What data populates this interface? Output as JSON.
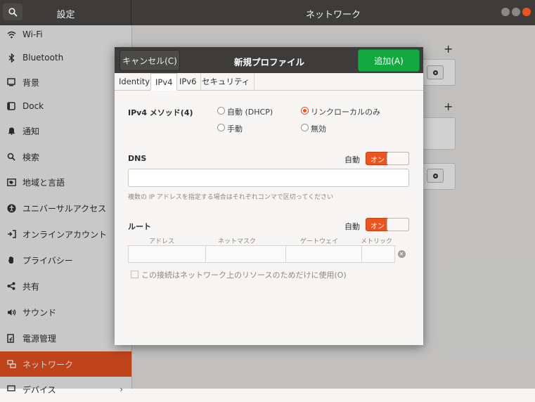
{
  "header": {
    "left_title": "設定",
    "title": "ネットワーク"
  },
  "sidebar": {
    "items": [
      {
        "label": "Wi-Fi",
        "icon": "wifi-icon"
      },
      {
        "label": "Bluetooth",
        "icon": "bluetooth-icon"
      },
      {
        "label": "背景",
        "icon": "background-icon"
      },
      {
        "label": "Dock",
        "icon": "dock-icon"
      },
      {
        "label": "通知",
        "icon": "bell-icon"
      },
      {
        "label": "検索",
        "icon": "search-icon"
      },
      {
        "label": "地域と言語",
        "icon": "region-icon"
      },
      {
        "label": "ユニバーサルアクセス",
        "icon": "accessibility-icon"
      },
      {
        "label": "オンラインアカウント",
        "icon": "online-accounts-icon"
      },
      {
        "label": "プライバシー",
        "icon": "privacy-hand-icon"
      },
      {
        "label": "共有",
        "icon": "share-icon"
      },
      {
        "label": "サウンド",
        "icon": "speaker-icon"
      },
      {
        "label": "電源管理",
        "icon": "power-icon"
      },
      {
        "label": "ネットワーク",
        "icon": "network-icon",
        "active": true
      },
      {
        "label": "デバイス",
        "icon": "devices-icon"
      }
    ],
    "active_color": "#e95420"
  },
  "dialog": {
    "cancel_label": "キャンセル(C)",
    "title": "新規プロファイル",
    "add_label": "追加(A)",
    "add_color": "#13a841",
    "tabs": [
      "Identity",
      "IPv4",
      "IPv6",
      "セキュリティ"
    ],
    "active_tab": "IPv4",
    "ipv4_method_label": "IPv4 メソッド(4)",
    "methods": [
      {
        "label": "自動 (DHCP)",
        "selected": false
      },
      {
        "label": "リンクローカルのみ",
        "selected": true
      },
      {
        "label": "手動",
        "selected": false
      },
      {
        "label": "無効",
        "selected": false
      }
    ],
    "dns": {
      "label": "DNS",
      "auto_label": "自動",
      "switch_label": "オン",
      "value": "",
      "hint": "複数の IP アドレスを指定する場合はそれぞれコンマで区切ってください"
    },
    "routes": {
      "label": "ルート",
      "auto_label": "自動",
      "switch_label": "オン",
      "columns": [
        "アドレス",
        "ネットマスク",
        "ゲートウェイ",
        "メトリック"
      ]
    },
    "checkbox_label": "この接続はネットワーク上のリソースのためだけに使用(O)"
  },
  "accent_color": "#e95420"
}
